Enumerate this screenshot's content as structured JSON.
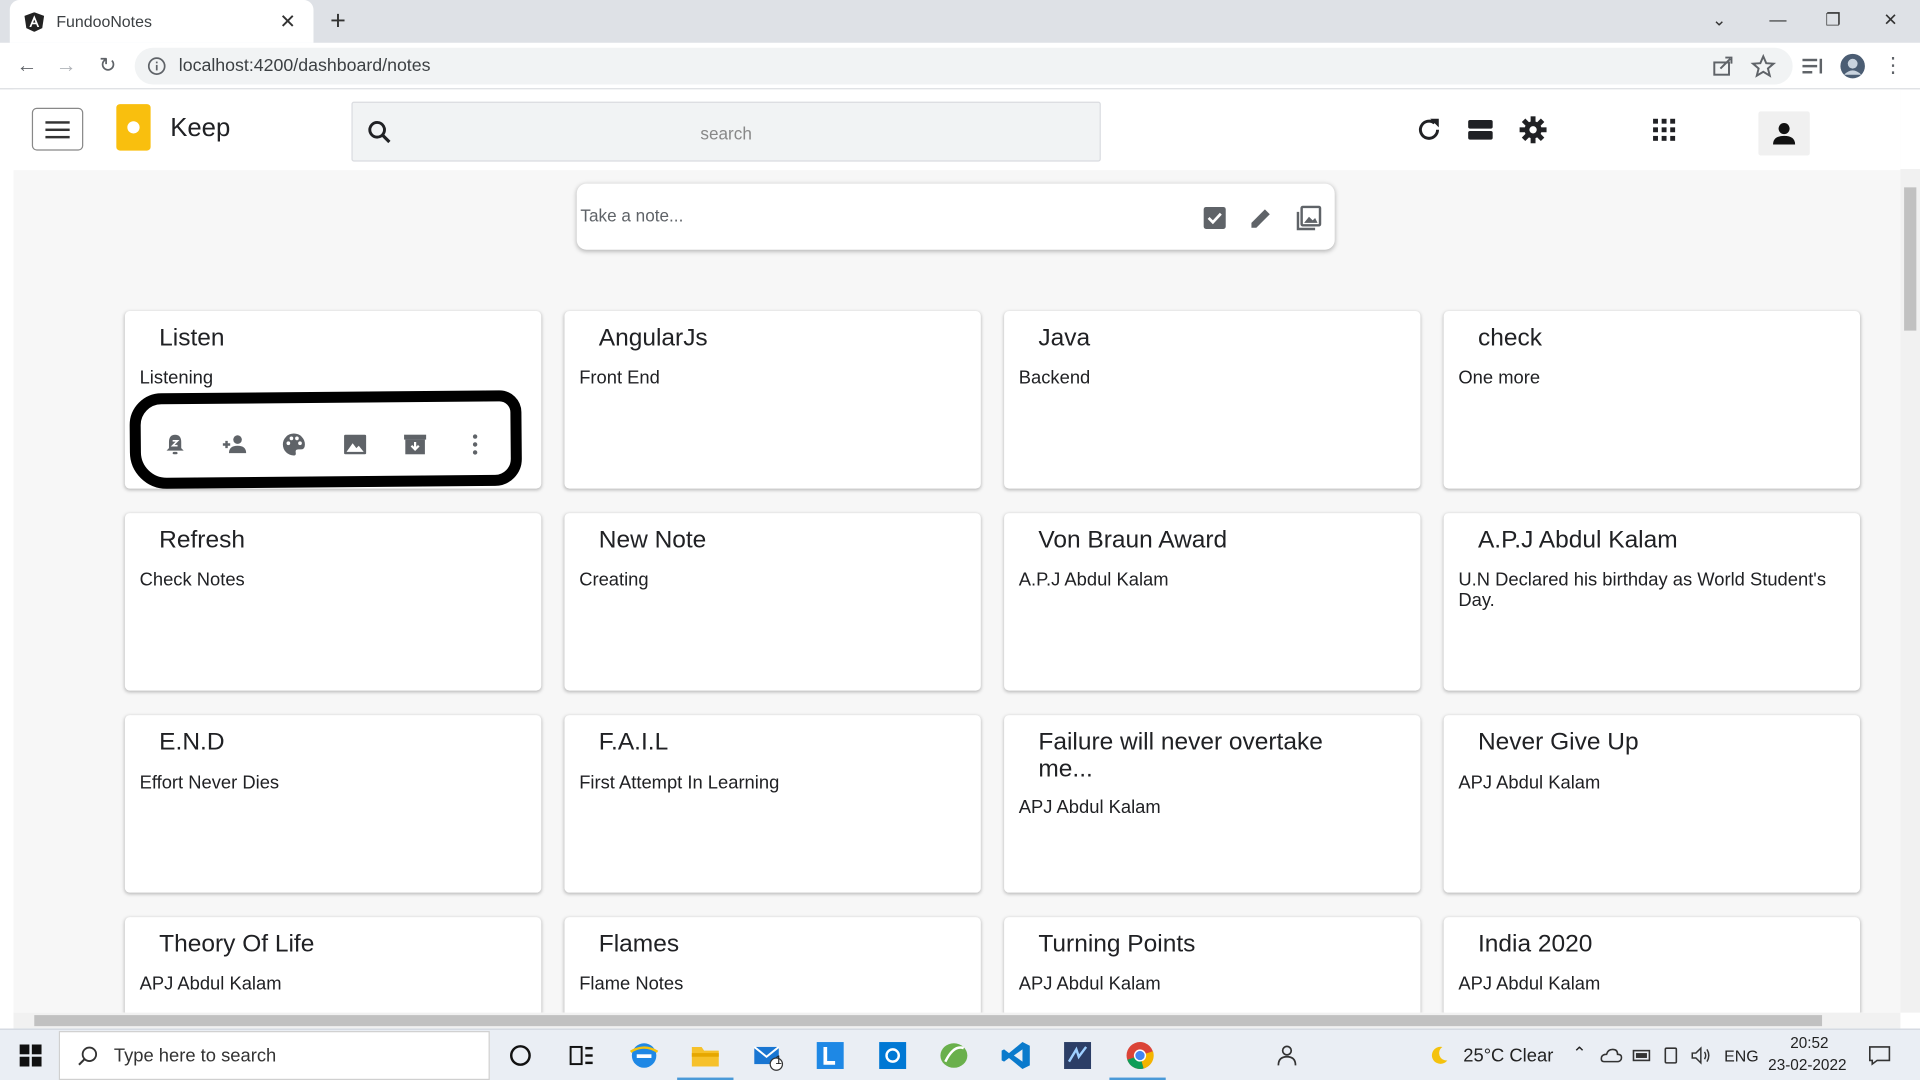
{
  "browser": {
    "tab_title": "FundooNotes",
    "url": "localhost:4200/dashboard/notes"
  },
  "header": {
    "app_title": "Keep",
    "search_placeholder": "search"
  },
  "take_note": {
    "placeholder": "Take a note..."
  },
  "notes": [
    {
      "title": "Listen",
      "description": "Listening"
    },
    {
      "title": "AngularJs",
      "description": "Front End"
    },
    {
      "title": "Java",
      "description": "Backend"
    },
    {
      "title": "check",
      "description": "One more"
    },
    {
      "title": "Refresh",
      "description": "Check Notes"
    },
    {
      "title": "New Note",
      "description": "Creating"
    },
    {
      "title": "Von Braun Award",
      "description": "A.P.J Abdul Kalam"
    },
    {
      "title": "A.P.J Abdul Kalam",
      "description": "U.N Declared his birthday as World Student's Day."
    },
    {
      "title": "E.N.D",
      "description": "Effort Never Dies"
    },
    {
      "title": "F.A.I.L",
      "description": "First Attempt In Learning"
    },
    {
      "title": "Failure will never overtake me...",
      "description": "APJ Abdul Kalam"
    },
    {
      "title": "Never Give Up",
      "description": "APJ Abdul Kalam"
    },
    {
      "title": "Theory Of Life",
      "description": "APJ Abdul Kalam"
    },
    {
      "title": "Flames",
      "description": "Flame Notes"
    },
    {
      "title": "Turning Points",
      "description": "APJ Abdul Kalam"
    },
    {
      "title": "India 2020",
      "description": "APJ Abdul Kalam"
    }
  ],
  "note_toolbar_icons": [
    "reminder-icon",
    "collaborator-icon",
    "palette-icon",
    "image-icon",
    "archive-icon",
    "more-vert-icon"
  ],
  "taskbar": {
    "search_placeholder": "Type here to search",
    "weather": "25°C  Clear",
    "language": "ENG",
    "time": "20:52",
    "date": "23-02-2022",
    "mail_badge": "1"
  },
  "colors": {
    "logo": "#f9bf0e",
    "app_background": "#f7f7f7",
    "highlight_stroke": "#000000"
  }
}
